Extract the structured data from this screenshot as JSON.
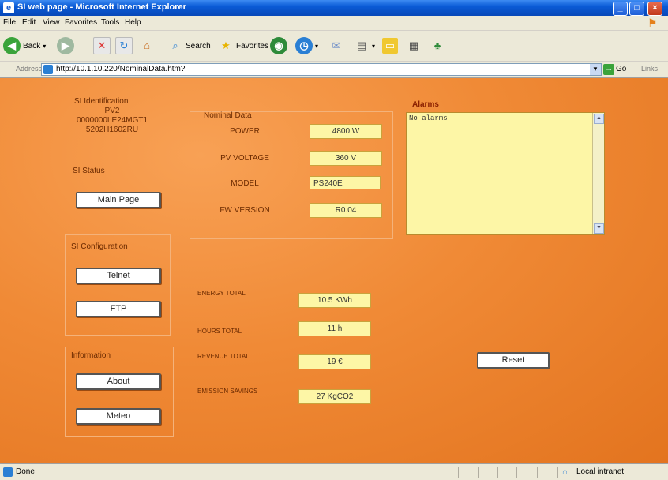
{
  "window": {
    "title": "SI web page - Microsoft Internet Explorer"
  },
  "menu": [
    "File",
    "Edit",
    "View",
    "Favorites",
    "Tools",
    "Help"
  ],
  "toolbar": {
    "back": "Back",
    "search": "Search",
    "favorites": "Favorites"
  },
  "address": {
    "label": "Address",
    "url": "http://10.1.10.220/NominalData.htm?",
    "go": "Go",
    "links": "Links"
  },
  "page": {
    "si_identification": {
      "title": "SI Identification",
      "lines": [
        "PV2",
        "0000000LE24MGT1",
        "5202H1602RU"
      ]
    },
    "si_status": {
      "title": "SI Status",
      "main_page_button": "Main Page"
    },
    "si_configuration": {
      "title": "SI Configuration",
      "telnet_button": "Telnet",
      "ftp_button": "FTP"
    },
    "information": {
      "title": "Information",
      "about_button": "About",
      "meteo_button": "Meteo"
    },
    "nominal_data": {
      "title": "Nominal Data",
      "rows": [
        {
          "label": "POWER",
          "value": "4800 W"
        },
        {
          "label": "PV VOLTAGE",
          "value": "360 V"
        },
        {
          "label": "MODEL",
          "value": "PS240E"
        },
        {
          "label": "FW VERSION",
          "value": "R0.04"
        }
      ]
    },
    "alarms": {
      "title": "Alarms",
      "text": "No alarms"
    },
    "totals": [
      {
        "label": "ENERGY TOTAL",
        "value": "10.5 KWh"
      },
      {
        "label": "HOURS TOTAL",
        "value": "11 h"
      },
      {
        "label": "REVENUE TOTAL",
        "value": "19 €"
      },
      {
        "label": "EMISSION SAVINGS",
        "value": "27 KgCO2"
      }
    ],
    "reset_button": "Reset"
  },
  "status": {
    "text": "Done",
    "zone": "Local intranet"
  },
  "colors": {
    "page_orange": "#f08a36",
    "field_yellow": "#fdf6a6",
    "xp_blue": "#0a5bd6"
  }
}
